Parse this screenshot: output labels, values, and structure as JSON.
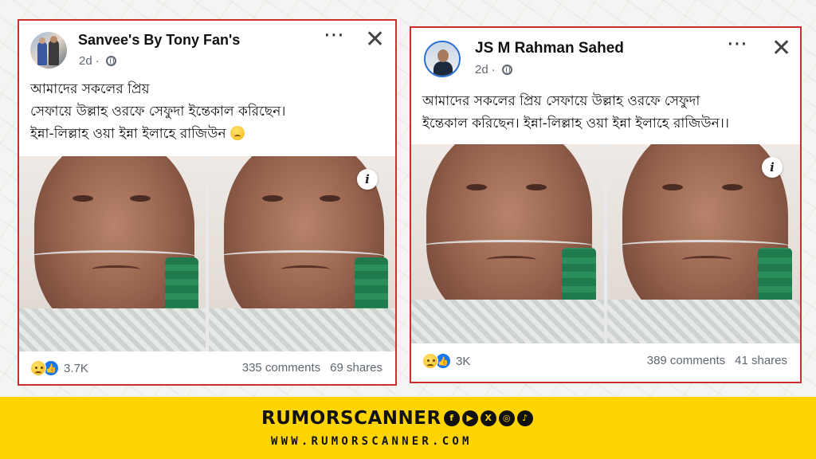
{
  "posts": [
    {
      "author": "Sanvee's By Tony Fan's",
      "time": "2d",
      "text": "আমাদের সকলের প্রিয়\n সেফায়ে উল্লাহ ওরফে সেফুদা ইন্তেকাল করিছেন।\nইন্না-লিল্লাহ ওয়া ইন্না ইলাহে রাজিউন",
      "reactions": "3.7K",
      "comments": "335 comments",
      "shares": "69 shares"
    },
    {
      "author": "JS M Rahman Sahed",
      "time": "2d",
      "text": "আমাদের সকলের প্রিয় সেফায়ে উল্লাহ ওরফে সেফুদা\nইন্তেকাল করিছেন। ইন্না-লিল্লাহ ওয়া ইন্না ইলাহে রাজিউন।।",
      "reactions": "3K",
      "comments": "389 comments",
      "shares": "41 shares"
    }
  ],
  "icons": {
    "more": "⋯",
    "close": "✕",
    "info": "i",
    "like": "👍"
  },
  "branding": {
    "name": "RUMORSCANNER",
    "url": "WWW.RUMORSCANNER.COM",
    "social": [
      "f",
      "▶",
      "X",
      "◎",
      "♪"
    ]
  },
  "colors": {
    "post_border": "#c9302c",
    "banner": "#ffd400",
    "like_blue": "#1877f2"
  }
}
